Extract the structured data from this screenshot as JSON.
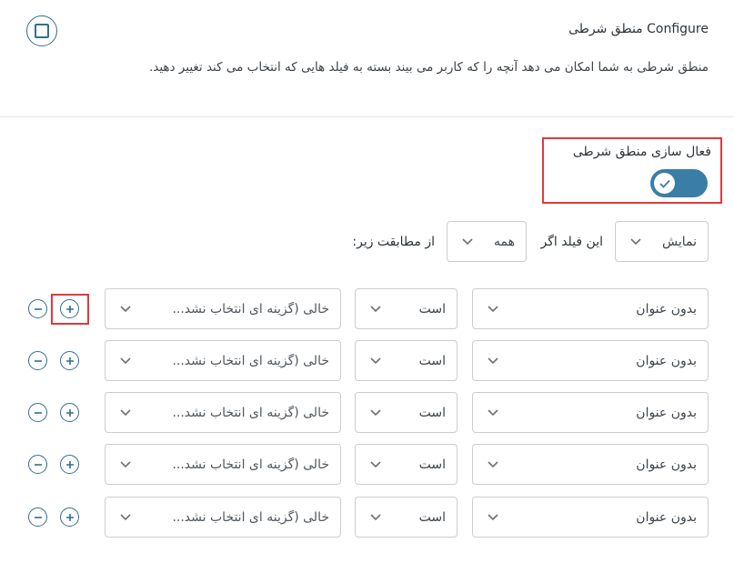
{
  "header": {
    "title": "منطق شرطی Configure",
    "description": "منطق شرطی به شما امکان می دهد آنچه را که کاربر می بیند بسته به فیلد هایی که انتخاب می کند تغییر دهید."
  },
  "toggle": {
    "label": "فعال سازی منطق شرطی",
    "enabled": true
  },
  "rule": {
    "action_value": "نمایش",
    "if_label": "این فیلد اگر",
    "match_value": "همه",
    "match_suffix": "از مطابقت زیر:"
  },
  "conditions": [
    {
      "field": "بدون عنوان",
      "operator": "است",
      "value": "خالی (گزینه ای انتخاب نشد..."
    },
    {
      "field": "بدون عنوان",
      "operator": "است",
      "value": "خالی (گزینه ای انتخاب نشد..."
    },
    {
      "field": "بدون عنوان",
      "operator": "است",
      "value": "خالی (گزینه ای انتخاب نشد..."
    },
    {
      "field": "بدون عنوان",
      "operator": "است",
      "value": "خالی (گزینه ای انتخاب نشد..."
    },
    {
      "field": "بدون عنوان",
      "operator": "است",
      "value": "خالی (گزینه ای انتخاب نشد..."
    }
  ],
  "colors": {
    "accent": "#3a7da7",
    "highlight": "#e0393e",
    "border": "#c9ced3"
  },
  "icons": {
    "header": "square-icon",
    "toggle_knob": "check-icon",
    "select": "chevron-down-icon",
    "add": "plus-icon",
    "remove": "minus-icon"
  }
}
